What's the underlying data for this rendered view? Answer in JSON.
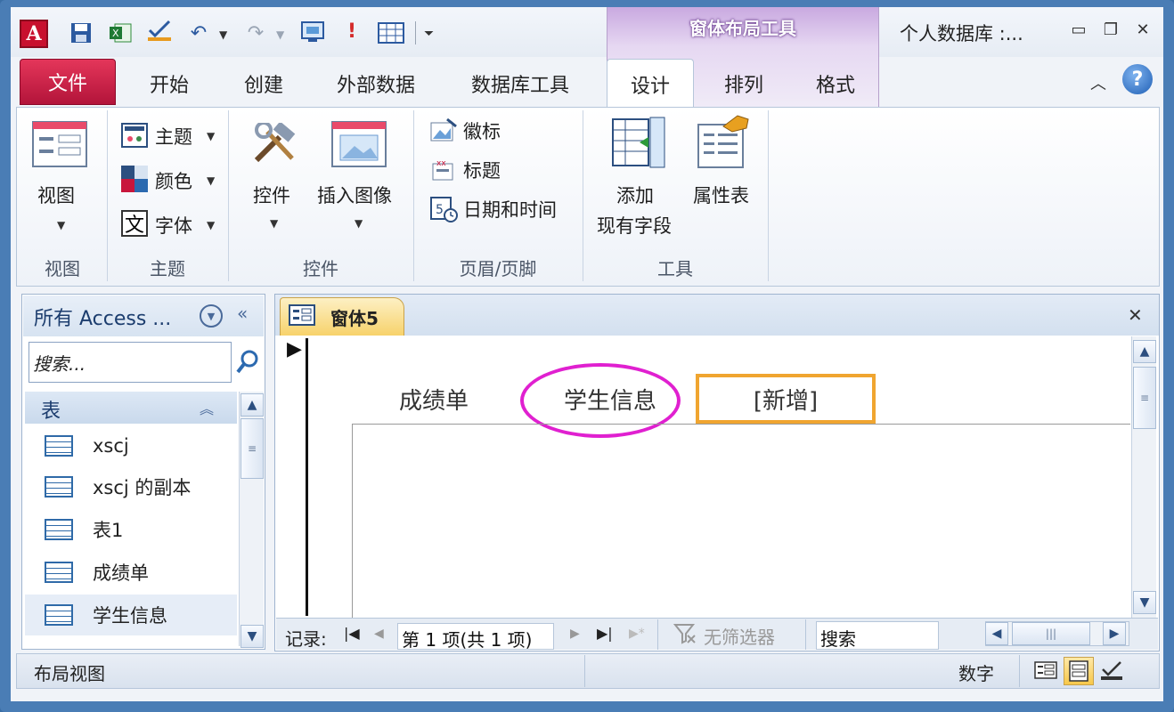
{
  "app": {
    "context_tool_title": "窗体布局工具",
    "document_title": "个人数据库 :..."
  },
  "qat": {
    "icons": [
      "access-logo",
      "save-icon",
      "excel-icon",
      "checklist-icon",
      "undo-icon",
      "redo-icon",
      "view-icon",
      "exclamation-icon",
      "table-icon",
      "customize-icon"
    ]
  },
  "tabs": {
    "file": "文件",
    "home": "开始",
    "create": "创建",
    "external": "外部数据",
    "dbtools": "数据库工具",
    "design": "设计",
    "arrange": "排列",
    "format": "格式"
  },
  "ribbon": {
    "views": {
      "button": "视图",
      "label": "视图"
    },
    "themes": {
      "theme": "主题",
      "colors": "颜色",
      "fonts": "字体",
      "label": "主题"
    },
    "controls": {
      "controls": "控件",
      "insert_image": "插入图像",
      "label": "控件"
    },
    "header_footer": {
      "logo": "徽标",
      "title": "标题",
      "datetime": "日期和时间",
      "label": "页眉/页脚"
    },
    "tools": {
      "add_fields_1": "添加",
      "add_fields_2": "现有字段",
      "property_sheet": "属性表",
      "label": "工具"
    }
  },
  "nav": {
    "title": "所有 Access ...",
    "search_placeholder": "搜索...",
    "group": "表",
    "items": [
      "xscj",
      "xscj 的副本",
      "表1",
      "成绩单",
      "学生信息"
    ]
  },
  "doc": {
    "tab_label": "窗体5",
    "form_tabs": [
      "成绩单",
      "学生信息",
      "[新增]"
    ]
  },
  "recnav": {
    "label": "记录:",
    "position": "第 1 项(共 1 项)",
    "filter": "无筛选器",
    "search": "搜索"
  },
  "status": {
    "view": "布局视图",
    "numlock": "数字"
  },
  "colors": {
    "file_tab": "#c8163c",
    "highlight_circle": "#e020d0",
    "selected_tab_border": "#f0a530"
  }
}
